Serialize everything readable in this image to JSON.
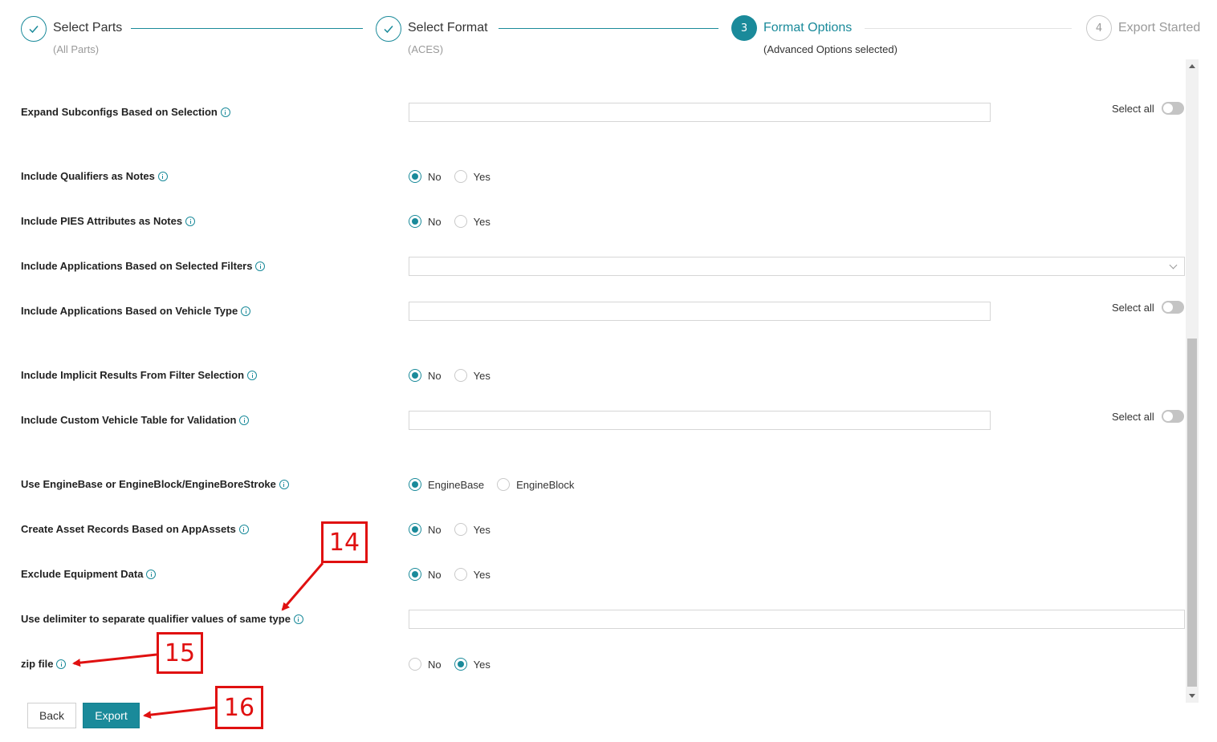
{
  "stepper": {
    "steps": [
      {
        "number": "",
        "title": "Select Parts",
        "subtitle": "(All Parts)",
        "state": "done",
        "icon": "check-icon"
      },
      {
        "number": "",
        "title": "Select Format",
        "subtitle": "(ACES)",
        "state": "done",
        "icon": "check-icon"
      },
      {
        "number": "3",
        "title": "Format Options",
        "subtitle": "(Advanced Options selected)",
        "state": "active"
      },
      {
        "number": "4",
        "title": "Export Started",
        "subtitle": "",
        "state": "pending"
      }
    ]
  },
  "form": {
    "rows": [
      {
        "label": "Expand Subconfigs Based on Selection",
        "control": "text",
        "value": "",
        "select_all": "Select all"
      },
      {
        "label": "Include Qualifiers as Notes",
        "control": "radio",
        "options": [
          "No",
          "Yes"
        ],
        "selected": "No"
      },
      {
        "label": "Include PIES Attributes as Notes",
        "control": "radio",
        "options": [
          "No",
          "Yes"
        ],
        "selected": "No"
      },
      {
        "label": "Include Applications Based on Selected Filters",
        "control": "select",
        "value": ""
      },
      {
        "label": "Include Applications Based on Vehicle Type",
        "control": "text",
        "value": "",
        "select_all": "Select all"
      },
      {
        "label": "Include Implicit Results From Filter Selection",
        "control": "radio",
        "options": [
          "No",
          "Yes"
        ],
        "selected": "No"
      },
      {
        "label": "Include Custom Vehicle Table for Validation",
        "control": "text",
        "value": "",
        "select_all": "Select all"
      },
      {
        "label": "Use EngineBase or EngineBlock/EngineBoreStroke",
        "control": "radio",
        "options": [
          "EngineBase",
          "EngineBlock"
        ],
        "selected": "EngineBase"
      },
      {
        "label": "Create Asset Records Based on AppAssets",
        "control": "radio",
        "options": [
          "No",
          "Yes"
        ],
        "selected": "No"
      },
      {
        "label": "Exclude Equipment Data",
        "control": "radio",
        "options": [
          "No",
          "Yes"
        ],
        "selected": "No"
      },
      {
        "label": "Use delimiter to separate qualifier values of same type",
        "control": "text-wide",
        "value": ""
      },
      {
        "label": "zip file",
        "control": "radio",
        "options": [
          "No",
          "Yes"
        ],
        "selected": "Yes"
      }
    ]
  },
  "buttons": {
    "back": "Back",
    "export": "Export"
  },
  "annotations": {
    "callout_14": "14",
    "callout_15": "15",
    "callout_16": "16"
  },
  "colors": {
    "accent": "#1a8a9a",
    "annotation": "#e01010",
    "toggle_off": "#c4c4c4"
  }
}
